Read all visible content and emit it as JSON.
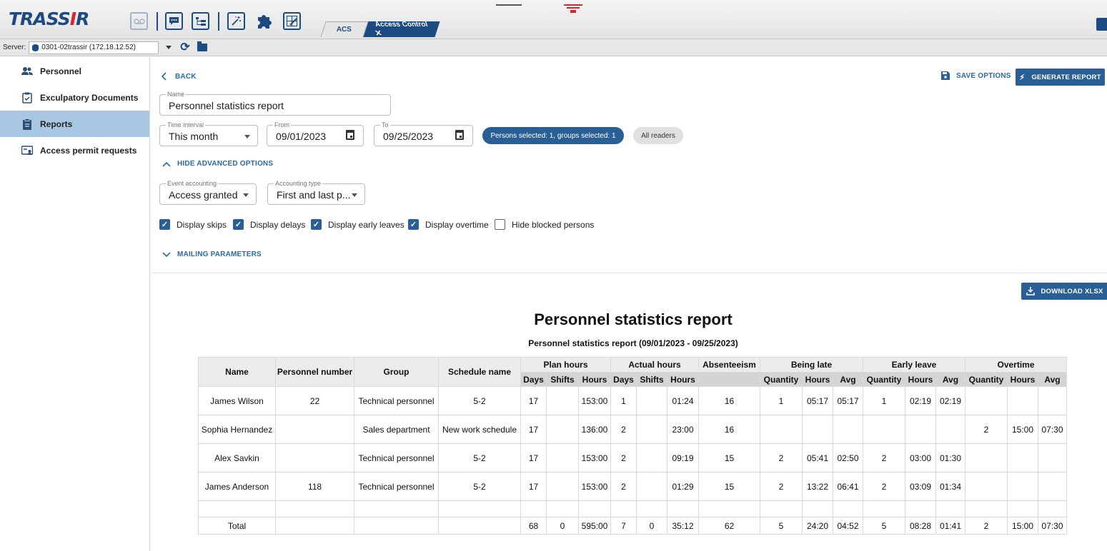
{
  "app": {
    "logo_text": "TRASSIR",
    "tabs": [
      "ACS",
      "Access Control"
    ],
    "close_glyph": "✕"
  },
  "serverbar": {
    "label": "Server:",
    "server": "0301-02trassir (172.18.12.52)"
  },
  "sidebar": {
    "items": [
      {
        "label": "Personnel",
        "icon": "people-icon"
      },
      {
        "label": "Exculpatory Documents",
        "icon": "clipboard-check-icon"
      },
      {
        "label": "Reports",
        "icon": "report-icon"
      },
      {
        "label": "Access permit requests",
        "icon": "badge-icon"
      }
    ],
    "active": "Reports"
  },
  "form": {
    "back": "BACK",
    "save_options": "SAVE OPTIONS",
    "generate_report": "GENERATE REPORT",
    "name": {
      "label": "Name",
      "value": "Personnel statistics report"
    },
    "time_interval": {
      "label": "Time interval",
      "value": "This month"
    },
    "from": {
      "label": "From",
      "value": "09/01/2023"
    },
    "to": {
      "label": "To",
      "value": "09/25/2023"
    },
    "persons_chip": "Persons selected: 1, groups selected: 1",
    "readers_chip": "All readers",
    "hide_advanced": "HIDE ADVANCED OPTIONS",
    "event_accounting": {
      "label": "Event accounting",
      "value": "Access granted"
    },
    "accounting_type": {
      "label": "Accounting type",
      "value": "First and last p..."
    },
    "checkboxes": [
      {
        "label": "Display skips",
        "checked": true
      },
      {
        "label": "Display delays",
        "checked": true
      },
      {
        "label": "Display early leaves",
        "checked": true
      },
      {
        "label": "Display overtime",
        "checked": true
      },
      {
        "label": "Hide blocked persons",
        "checked": false
      }
    ],
    "mailing": "MAILING PARAMETERS"
  },
  "report": {
    "download": "DOWNLOAD XLSX",
    "title": "Personnel statistics report",
    "subtitle": "Personnel statistics report (09/01/2023 - 09/25/2023)",
    "head_main": {
      "name": "Name",
      "personnel_number": "Personnel number",
      "group": "Group",
      "schedule": "Schedule name",
      "plan": "Plan hours",
      "actual": "Actual hours",
      "absenteeism": "Absenteeism",
      "late": "Being late",
      "early": "Early leave",
      "overtime": "Overtime"
    },
    "head_sub": [
      "Days",
      "Shifts",
      "Hours",
      "Days",
      "Shifts",
      "Hours",
      "",
      "Quantity",
      "Hours",
      "Avg",
      "Quantity",
      "Hours",
      "Avg",
      "Quantity",
      "Hours",
      "Avg"
    ],
    "rows": [
      [
        "James Wilson",
        "22",
        "Technical personnel",
        "5-2",
        "17",
        "",
        "153:00",
        "1",
        "",
        "01:24",
        "16",
        "1",
        "05:17",
        "05:17",
        "1",
        "02:19",
        "02:19",
        "",
        "",
        ""
      ],
      [
        "Sophia Hernandez",
        "",
        "Sales department",
        "New work schedule",
        "17",
        "",
        "136:00",
        "2",
        "",
        "23:00",
        "16",
        "",
        "",
        "",
        "",
        "",
        "",
        "2",
        "15:00",
        "07:30"
      ],
      [
        "Alex Savkin",
        "",
        "Technical personnel",
        "5-2",
        "17",
        "",
        "153:00",
        "2",
        "",
        "09:19",
        "15",
        "2",
        "05:41",
        "02:50",
        "2",
        "03:00",
        "01:30",
        "",
        "",
        ""
      ],
      [
        "James Anderson",
        "118",
        "Technical personnel",
        "5-2",
        "17",
        "",
        "153:00",
        "2",
        "",
        "01:29",
        "15",
        "2",
        "13:22",
        "06:41",
        "2",
        "03:09",
        "01:34",
        "",
        "",
        ""
      ],
      [
        "",
        "",
        "",
        "",
        "",
        "",
        "",
        "",
        "",
        "",
        "",
        "",
        "",
        "",
        "",
        "",
        "",
        "",
        "",
        ""
      ],
      [
        "Total",
        "",
        "",
        "",
        "68",
        "0",
        "595:00",
        "7",
        "0",
        "35:12",
        "62",
        "5",
        "24:20",
        "04:52",
        "5",
        "08:28",
        "01:41",
        "2",
        "15:00",
        "07:30"
      ]
    ]
  }
}
